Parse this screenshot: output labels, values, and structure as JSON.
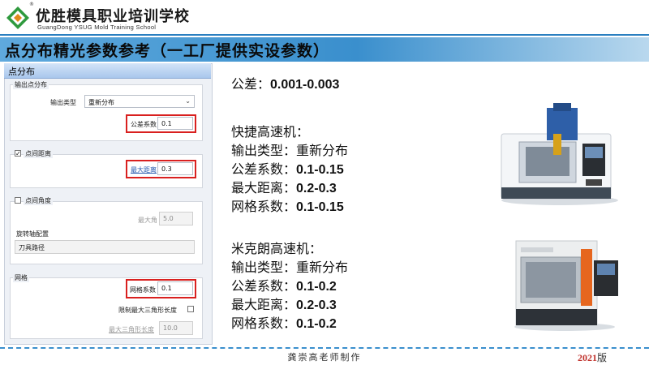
{
  "header": {
    "school_cn": "优胜模具职业培训学校",
    "school_en": "GuangDong YSUG Mold Training School",
    "registered": "®",
    "slide_title": "点分布精光参数参考（一工厂提供实设参数）"
  },
  "dialog": {
    "title": "点分布",
    "output_group": "输出点分布",
    "output_type_label": "输出类型",
    "output_type_value": "重新分布",
    "tolerance_factor_label": "公差系数",
    "tolerance_factor_value": "0.1",
    "point_distance_group": "点间距离",
    "point_distance_checked": true,
    "max_distance_label": "最大距离",
    "max_distance_value": "0.3",
    "point_angle_group": "点间角度",
    "point_angle_checked": false,
    "max_angle_label": "最大角",
    "max_angle_value": "5.0",
    "rotary_axis_label": "旋转轴配置",
    "tool_path_value": "刀具路径",
    "mesh_group": "网格",
    "mesh_factor_label": "网格系数",
    "mesh_factor_value": "0.1",
    "limit_triangle_label": "限制最大三角形长度",
    "limit_triangle_checked": false,
    "max_triangle_label": "最大三角形长度",
    "max_triangle_value": "10.0"
  },
  "content": {
    "tolerance_line_label": "公差：",
    "tolerance_line_value": "0.001-0.003",
    "machine1": {
      "name": "快捷高速机：",
      "type_label": "输出类型：",
      "type_value": "重新分布",
      "tol_label": "公差系数：",
      "tol_value": "0.1-0.15",
      "dist_label": "最大距离：",
      "dist_value": "0.2-0.3",
      "mesh_label": "网格系数：",
      "mesh_value": "0.1-0.15"
    },
    "machine2": {
      "name": "米克朗高速机：",
      "type_label": "输出类型：",
      "type_value": "重新分布",
      "tol_label": "公差系数：",
      "tol_value": "0.1-0.2",
      "dist_label": "最大距离：",
      "dist_value": "0.2-0.3",
      "mesh_label": "网格系数：",
      "mesh_value": "0.1-0.2"
    }
  },
  "footer": {
    "author": "龚崇高老师制作",
    "year": "2021",
    "edition": "版"
  },
  "colors": {
    "accent_blue": "#3a8fcd",
    "highlight_red": "#d9201f"
  }
}
